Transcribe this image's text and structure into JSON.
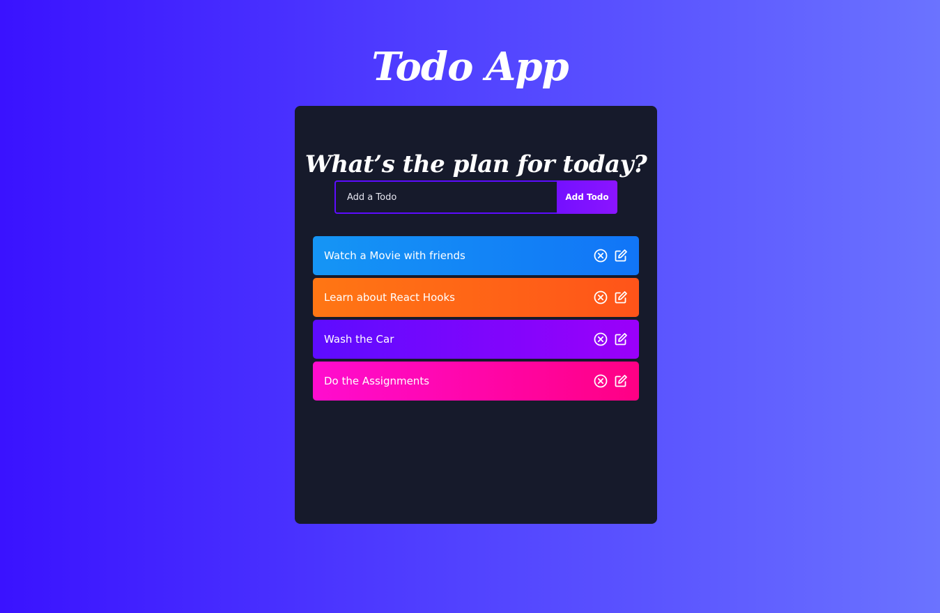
{
  "app": {
    "title": "Todo App"
  },
  "panel": {
    "heading": "What’s the plan for today?"
  },
  "form": {
    "input_placeholder": "Add a Todo",
    "input_value": "",
    "button_label": "Add Todo"
  },
  "todos": [
    {
      "text": "Watch a Movie with friends",
      "color": "blue",
      "icons": [
        "close-circle-icon",
        "edit-icon"
      ]
    },
    {
      "text": "Learn about React Hooks",
      "color": "orange",
      "icons": [
        "close-circle-icon",
        "edit-icon"
      ]
    },
    {
      "text": "Wash the Car",
      "color": "purple",
      "icons": [
        "close-circle-icon",
        "edit-icon"
      ]
    },
    {
      "text": "Do the Assignments",
      "color": "pink",
      "icons": [
        "close-circle-icon",
        "edit-icon"
      ]
    }
  ],
  "colors": {
    "background_start": "#3a12ff",
    "background_end": "#6b73ff",
    "panel": "#161a2b",
    "input_border": "#5d0cff",
    "button": "#7410ff",
    "todo_blue": "#1595f5",
    "todo_orange": "#ff7614",
    "todo_purple": "#5d0cff",
    "todo_pink": "#ff0ccf"
  }
}
